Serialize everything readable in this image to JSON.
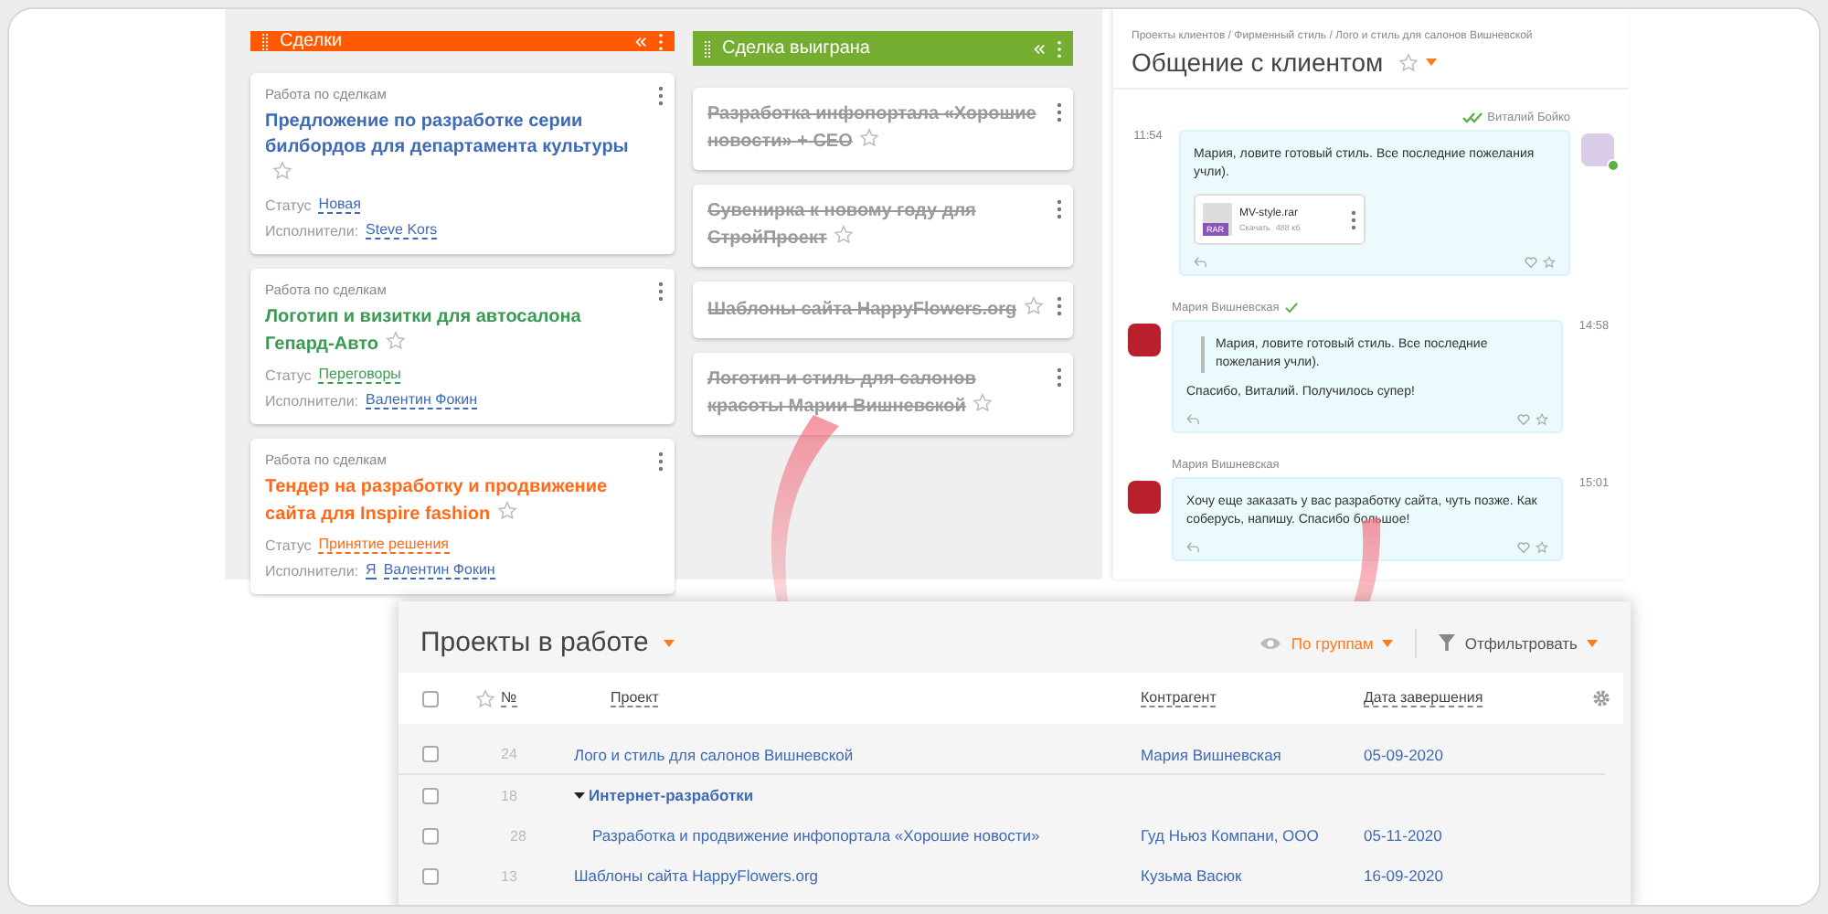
{
  "kanban": {
    "columns": [
      {
        "title": "Сделки",
        "color": "#ff5a00",
        "cards": [
          {
            "kind": "active",
            "category": "Работа по сделкам",
            "title": "Предложение по разработке серии билбордов для департамента культуры",
            "color": "#3f6ab5",
            "status_label": "Статус",
            "status": "Новая",
            "assignees_label": "Исполнители:",
            "assignees": [
              "Steve Kors"
            ],
            "starred": false
          },
          {
            "kind": "active",
            "category": "Работа по сделкам",
            "title": "Логотип и визитки для автосалона Гепард-Авто",
            "color": "#3a9a54",
            "status_label": "Статус",
            "status": "Переговоры",
            "assignees_label": "Исполнители:",
            "assignees": [
              "Валентин Фокин"
            ],
            "starred": false
          },
          {
            "kind": "active",
            "category": "Работа по сделкам",
            "title": "Тендер на разработку и продвижение сайта для Inspire fashion",
            "color": "#ff6a1a",
            "status_label": "Статус",
            "status": "Принятие решения",
            "assignees_label": "Исполнители:",
            "assignees": [
              "Я",
              "Валентин Фокин"
            ],
            "starred": false
          }
        ]
      },
      {
        "title": "Сделка выиграна",
        "color": "#74ad30",
        "cards": [
          {
            "kind": "won",
            "title": "Разработка инфопортала «Хорошие новости» + СЕО",
            "color": "#9a9a9a",
            "starred": false
          },
          {
            "kind": "won",
            "title": "Сувенирка к новому году для СтройПроект",
            "color": "#9a9a9a",
            "starred": false
          },
          {
            "kind": "won",
            "title": "Шаблоны сайта HappyFlowers.org",
            "color": "#9a9a9a",
            "starred": false
          },
          {
            "kind": "won",
            "title": "Логотип и стиль для салонов красоты Марии Вишневской",
            "color": "#9a9a9a",
            "starred": false
          }
        ]
      }
    ]
  },
  "chat": {
    "breadcrumb": "Проекты клиентов / Фирменный стиль / Лого и стиль для салонов Вишневской",
    "title": "Общение с клиентом",
    "starred": false,
    "messages": [
      {
        "kind": "outgoing",
        "author": "Виталий Бойко",
        "delivered": true,
        "read": true,
        "time": "11:54",
        "online": true,
        "text": "Мария, ловите готовый стиль. Все последние пожелания учли).",
        "attachment": {
          "badge": "RAR",
          "name": "MV-style.rar",
          "action": "Скачать",
          "size": "488 кб"
        }
      },
      {
        "kind": "incoming",
        "author": "Мария Вишневская",
        "delivered": true,
        "read": false,
        "time": "14:58",
        "online": false,
        "quote": "Мария, ловите готовый стиль. Все последние пожелания учли).",
        "text": "Спасибо, Виталий. Получилось супер!"
      },
      {
        "kind": "incoming",
        "author": "Мария Вишневская",
        "delivered": false,
        "read": false,
        "time": "15:01",
        "online": false,
        "text": "Хочу еще заказать у вас разработку сайта, чуть позже. Как соберусь, напишу. Спасибо большое!"
      }
    ]
  },
  "projects": {
    "title": "Проекты в работе",
    "select_all_checked": false,
    "group_button": "По группам",
    "filter_button": "Отфильтровать",
    "columns": [
      "№",
      "Проект",
      "Контрагент",
      "Дата завершения"
    ],
    "rows": [
      {
        "kind": "item",
        "checked": false,
        "number": "24",
        "project": "Лого и стиль для салонов Вишневской",
        "client": "Мария Вишневская",
        "date": "05-09-2020"
      },
      {
        "kind": "group",
        "checked": false,
        "number": "18",
        "project": "Интернет-разработки",
        "expanded": true,
        "children": [
          {
            "kind": "item",
            "checked": false,
            "number": "28",
            "project": "Разработка и продвижение инфопортала «Хорошие новости»",
            "client": "Гуд Ньюз Компани, ООО",
            "date": "05-11-2020"
          }
        ]
      },
      {
        "kind": "item",
        "checked": false,
        "number": "13",
        "project": "Шаблоны сайта HappyFlowers.org",
        "client": "Кузьма Васюк",
        "date": "16-09-2020"
      }
    ]
  }
}
